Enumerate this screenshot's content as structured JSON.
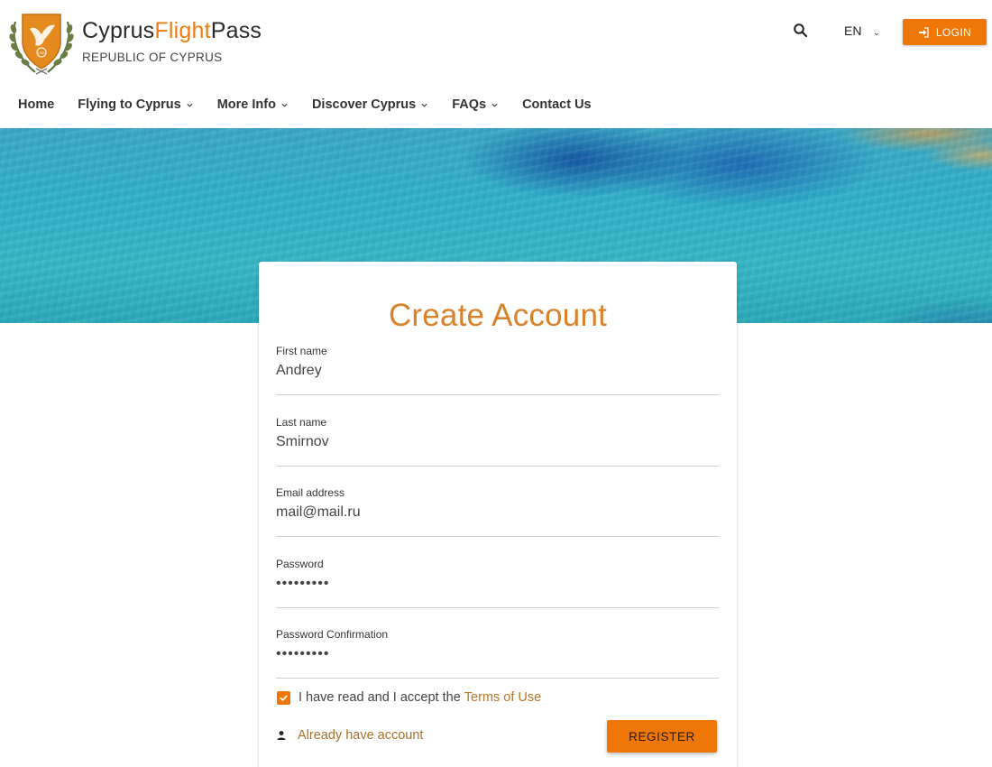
{
  "brand": {
    "name_part1": "Cyprus",
    "name_part2": "Flight",
    "name_part3": "Pass",
    "subtitle": "REPUBLIC OF CYPRUS",
    "accent_color": "#ee7d12",
    "emblem_year": "1960"
  },
  "header": {
    "search_icon": "search-icon",
    "language": "EN",
    "login_label": "LOGIN"
  },
  "nav": {
    "items": [
      {
        "label": "Home",
        "has_dropdown": false
      },
      {
        "label": "Flying to Cyprus",
        "has_dropdown": true
      },
      {
        "label": "More Info",
        "has_dropdown": true
      },
      {
        "label": "Discover Cyprus",
        "has_dropdown": true
      },
      {
        "label": "FAQs",
        "has_dropdown": true
      },
      {
        "label": "Contact Us",
        "has_dropdown": false
      }
    ]
  },
  "form": {
    "title": "Create Account",
    "fields": [
      {
        "label": "First name",
        "value": "Andrey",
        "type": "text"
      },
      {
        "label": "Last name",
        "value": "Smirnov",
        "type": "text"
      },
      {
        "label": "Email address",
        "value": "mail@mail.ru",
        "type": "email"
      },
      {
        "label": "Password",
        "value": "123456789",
        "type": "password"
      },
      {
        "label": "Password Confirmation",
        "value": "123456789",
        "type": "password"
      }
    ],
    "terms_text": "I have read and I accept the",
    "terms_link": "Terms of Use",
    "terms_checked": true,
    "already_account": "Already have account",
    "register_label": "REGISTER",
    "button_color": "#ee7708"
  }
}
